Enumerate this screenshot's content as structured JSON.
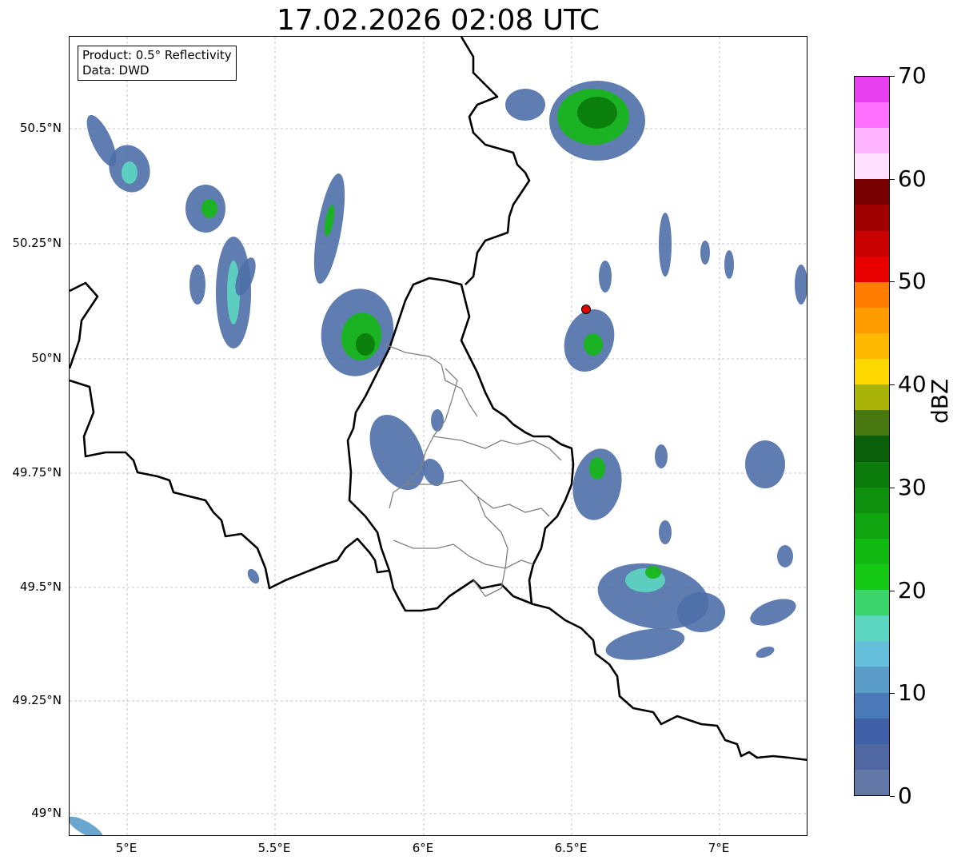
{
  "title": "17.02.2026 02:08 UTC",
  "info_box": {
    "product": "Product: 0.5° Reflectivity",
    "data": "Data: DWD"
  },
  "lat_labels": [
    "50.5°N",
    "50.25°N",
    "50°N",
    "49.75°N",
    "49.5°N",
    "49.25°N",
    "49°N"
  ],
  "lon_labels": [
    "5°E",
    "5.5°E",
    "6°E",
    "6.5°E",
    "7°E"
  ],
  "colorbar": {
    "title": "dBZ",
    "tick_labels": [
      "0",
      "10",
      "20",
      "30",
      "40",
      "50",
      "60",
      "70"
    ],
    "colors": [
      "#6478a8",
      "#4f68a2",
      "#4060a8",
      "#4a7ab8",
      "#5a9cc8",
      "#66c0dc",
      "#5cd6c0",
      "#3cd46c",
      "#14c814",
      "#12b812",
      "#10a410",
      "#0e900e",
      "#0c7c0c",
      "#0a600a",
      "#4a7810",
      "#aab408",
      "#ffd800",
      "#ffb800",
      "#ff9c00",
      "#ff7c00",
      "#e80000",
      "#c80000",
      "#a00000",
      "#780000",
      "#ffe0ff",
      "#ffb4ff",
      "#ff70ff",
      "#e840f0"
    ]
  },
  "marker": {
    "label": "radar-site",
    "color": "#e00000"
  }
}
